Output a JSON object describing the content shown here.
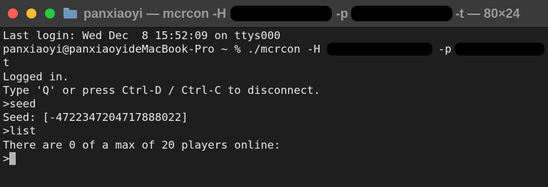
{
  "window": {
    "title_prefix": "panxiaoyi — mcrcon -H",
    "title_middle": "-p",
    "title_suffix": "-t — 80×24"
  },
  "terminal": {
    "line_login": "Last login: Wed Dec  8 15:52:09 on ttys000",
    "prompt": "panxiaoyi@panxiaoyideMacBook-Pro ~ % ./mcrcon -H",
    "cmd_flag_p": "-p",
    "cmd_flag_t_wrap": "-",
    "cmd_flag_t_cont": "t",
    "line_logged_in": "Logged in.",
    "line_disconnect_hint": "Type 'Q' or press Ctrl-D / Ctrl-C to disconnect.",
    "cmd_seed": ">seed",
    "out_seed": "Seed: [-4722347204717888022]",
    "cmd_list": ">list",
    "out_list": "There are 0 of a max of 20 players online:",
    "input_prompt": ">"
  }
}
